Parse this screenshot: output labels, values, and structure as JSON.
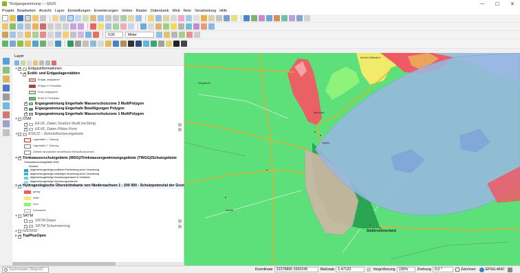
{
  "window": {
    "title": "*Erdgasgewinnung — QGIS",
    "minimize": "—",
    "maximize": "☐",
    "close": "✕"
  },
  "menu": [
    "Projekt",
    "Bearbeiten",
    "Ansicht",
    "Layer",
    "Einstellungen",
    "Erweiterungen",
    "Vektor",
    "Raster",
    "Datenbank",
    "Web",
    "Netz",
    "Verarbeitung",
    "Hilfe"
  ],
  "toolbar": {
    "zoom_value": "0,00",
    "unit": "Meter"
  },
  "panel": {
    "title": "Layer"
  },
  "layers": {
    "g_erdgas": "Erdgasinformationen",
    "l_lager": "Erdöl- und Erdgaslagerstätten",
    "leg_lager": [
      "Erdgas, aufgegeben",
      "Erdgas, in Produktion",
      "Erdöl, aufgegeben",
      "Erdöl, in Produktion"
    ],
    "l_wsz2": "Ergasgewinnung Engerhafe Wasserschutzzone 2 MultiPolygon",
    "l_bew": "Ergasgewinnung Engerhafe Bewilligungen Polygon",
    "l_wsz1": "Ergasgewinnung Engerhafe Wasserschutzzone 1 MultiPolygon",
    "g_osm": "OSM",
    "l_strassen": "EEVE_Daten Straßen MultiLineString",
    "l_plaetze": "EEVE_Daten Plätze Point",
    "l_rskjs": "RSKJS – Rohstoffsicherungskarte",
    "leg_rskjs": [
      "Lagerstätte 1. Ordnung",
      "Lagerstätte 2. Ordnung",
      "Gebiete mit potentiell verwertbaren Rohstoffvorkommen"
    ],
    "l_wsg": "Trinkwasserschutzgebiete (WSG)/Trinkwassergewinnungsgebiete (TWGG)/Schutzgebiete",
    "leg_wsg": [
      "Trinkwasserschutzgebiete WSG",
      "Zustand",
      "Allgemeinzugehörige preliktiver Festsetzung durch Verordnung",
      "Allgemeinzugehörige vorläufigen Anordnung durch Verordnung",
      "Allgemeinzugehörige Verordnungsentwurf in Verfahren",
      "Allgemeinzugehörige Verordnungsentwurfe"
    ],
    "l_hyd": "Hydrogeologische Übersichtskarte von Niedersachsen 1 : 200 000 - Schutzpotenzial der Grundwasserüberdeckung",
    "leg_hyd": [
      "gering",
      "mittel",
      "hoch",
      "Grenzwerte"
    ],
    "g_srtm": "SRTM",
    "l_srtm_daten": "SRTM Daten",
    "l_srtm_schumm": "SRTM Schummerung",
    "l_full": "full25832",
    "l_top": "TopPlusOpen"
  },
  "map_labels": {
    "aurich": "Aurich-Oldendorf",
    "moordorf": "Moordorf",
    "oppen": "Oppen",
    "suedbrook": "Südbrookmerland",
    "left1": "Siegelsum",
    "left2": "Abelitz"
  },
  "status": {
    "search_placeholder": "Suchmuster (Strg+K)",
    "coord_label": "Koordinate",
    "coord_value": "32378896 5930245",
    "scale_label": "Maßstab",
    "scale_value": "1:47122",
    "magnifier_label": "Vergrößerung",
    "magnifier_value": "100%",
    "rotation_label": "Drehung",
    "rotation_value": "0,0 °",
    "render_label": "Zeichnen",
    "crs": "EPSG:4647"
  },
  "colors": {
    "map_bg": "#5de07a",
    "hydro_low": "#f05a64",
    "hydro_mid": "#f2ea6a",
    "hydro_high": "#8ff27a",
    "wsz_blue": "#9ab8e4",
    "bewilligung": "#2aa653",
    "road": "#f5a623"
  }
}
